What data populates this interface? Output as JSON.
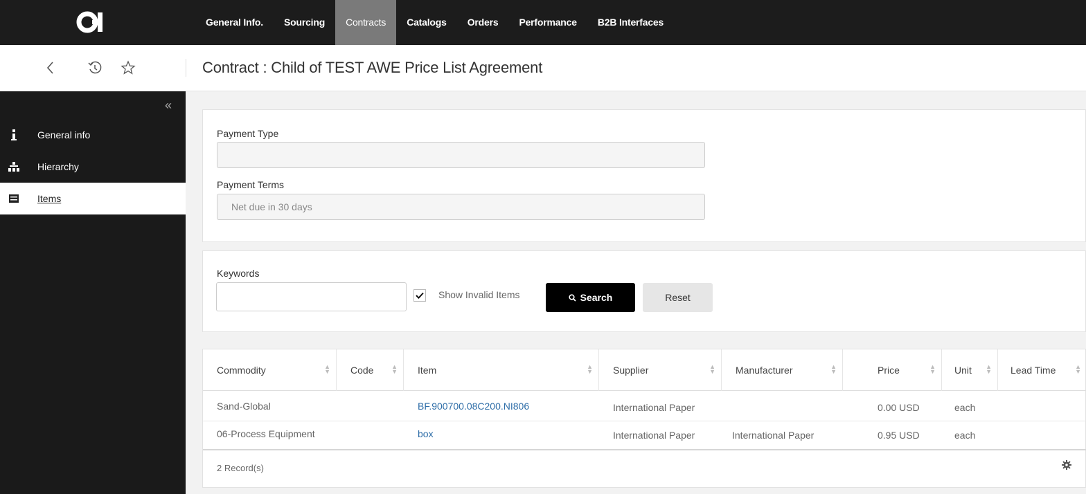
{
  "nav": {
    "logo_text": "O-I",
    "items": [
      "General Info.",
      "Sourcing",
      "Contracts",
      "Catalogs",
      "Orders",
      "Performance",
      "B2B Interfaces"
    ],
    "active_index": 2
  },
  "subbar": {
    "back_icon": "chevron-left-icon",
    "history_icon": "history-icon",
    "favorite_icon": "star-outline-icon",
    "title": "Contract : Child of TEST AWE Price List Agreement"
  },
  "sidebar": {
    "collapse_icon": "double-chevron-left-icon",
    "items": [
      {
        "label": "General info",
        "icon": "info-icon"
      },
      {
        "label": "Hierarchy",
        "icon": "hierarchy-icon"
      },
      {
        "label": "Items",
        "icon": "list-icon",
        "active": true
      }
    ]
  },
  "payment": {
    "type_label": "Payment Type",
    "type_value": "",
    "terms_label": "Payment Terms",
    "terms_value": "Net due in 30 days"
  },
  "search": {
    "keywords_label": "Keywords",
    "keywords_value": "",
    "show_invalid_label": "Show Invalid Items",
    "show_invalid_checked": true,
    "search_button": "Search",
    "reset_button": "Reset"
  },
  "table": {
    "columns": [
      "Commodity",
      "Code",
      "Item",
      "Supplier",
      "Manufacturer",
      "Price",
      "Unit",
      "Lead Time"
    ],
    "rows": [
      {
        "commodity": "Sand-Global",
        "code": "",
        "item": "BF.900700.08C200.NI806",
        "supplier": "International Paper",
        "manufacturer": "",
        "price": "0.00 USD",
        "unit": "each",
        "lead_time": ""
      },
      {
        "commodity": "06-Process Equipment",
        "code": "",
        "item": "box",
        "supplier": "International Paper",
        "manufacturer": "International Paper",
        "price": "0.95 USD",
        "unit": "each",
        "lead_time": ""
      }
    ],
    "records": "2 Record(s)",
    "settings_icon": "gear-icon"
  },
  "colors": {
    "nav_bg": "#1c1c1c",
    "nav_active": "#7a7a7a",
    "link": "#2f6ea8",
    "search_button": "#000000"
  }
}
